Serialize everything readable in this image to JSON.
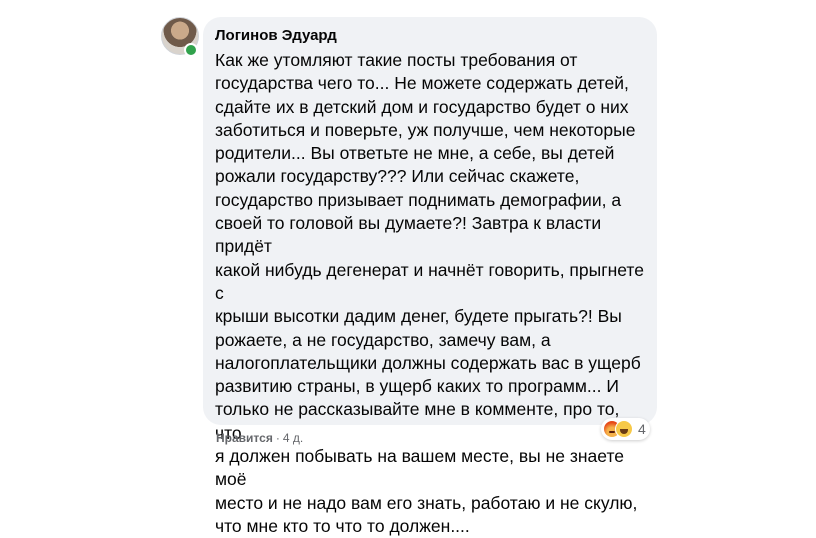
{
  "comment": {
    "author": "Логинов Эдуард",
    "text": "Как же утомляют такие посты требования от\nгосударства чего то... Не можете содержать детей,\nсдайте их в детский дом и государство будет о них\nзаботиться и поверьте, уж получше, чем некоторые\nродители... Вы ответьте не мне, а себе, вы детей\nрожали государству??? Или сейчас скажете,\nгосударство призывает поднимать демографии, а\nсвоей то головой вы думаете?! Завтра к власти придёт\nкакой нибудь дегенерат и начнёт говорить, прыгнете с\nкрыши высотки дадим денег, будете прыгать?! Вы\nрожаете, а не государство, замечу вам, а\nналогоплательщики должны содержать вас в ущерб\nразвитию страны, в ущерб каких то программ... И\nтолько не рассказывайте мне в комменте, про то, что\nя должен побывать на вашем месте, вы не знаете моё\nместо и не надо вам его знать, работаю и не скулю,\nчто мне кто то что то должен....",
    "like_label": "Нравится",
    "separator": "·",
    "time": "4 д.",
    "reactions": {
      "icons": [
        "angry-reaction",
        "haha-reaction"
      ],
      "count": "4"
    }
  },
  "colors": {
    "bubble": "#f0f2f5",
    "text": "#050505",
    "meta": "#65676b",
    "online": "#31a24c"
  }
}
